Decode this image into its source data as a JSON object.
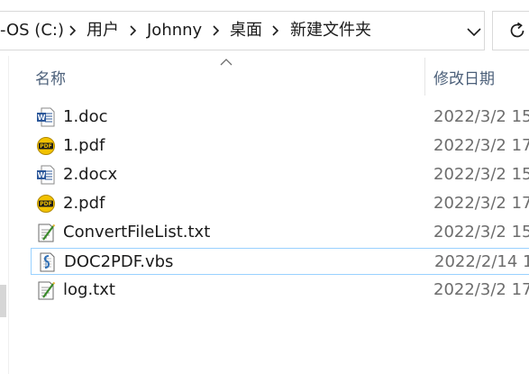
{
  "address_bar": {
    "segments": [
      "-OS (C:)",
      "用户",
      "Johnny",
      "桌面",
      "新建文件夹"
    ],
    "separator_icon": "chevron-right-icon",
    "dropdown_icon": "chevron-down-icon",
    "refresh_icon": "refresh-icon"
  },
  "columns": {
    "name": "名称",
    "date_modified": "修改日期",
    "sort_indicator": "sort-ascending-icon"
  },
  "files": [
    {
      "name": "1.doc",
      "date": "2022/3/2 15",
      "icon": "word-doc-icon",
      "selected": false
    },
    {
      "name": "1.pdf",
      "date": "2022/3/2 17",
      "icon": "pdf-icon",
      "selected": false
    },
    {
      "name": "2.docx",
      "date": "2022/3/2 15",
      "icon": "word-doc-icon",
      "selected": false
    },
    {
      "name": "2.pdf",
      "date": "2022/3/2 17",
      "icon": "pdf-icon",
      "selected": false
    },
    {
      "name": "ConvertFileList.txt",
      "date": "2022/3/2 15",
      "icon": "text-file-icon",
      "selected": false
    },
    {
      "name": "DOC2PDF.vbs",
      "date": "2022/2/14 1",
      "icon": "vbs-script-icon",
      "selected": true
    },
    {
      "name": "log.txt",
      "date": "2022/3/2 17",
      "icon": "text-file-icon",
      "selected": false
    }
  ],
  "colors": {
    "selection_border": "#99d1ff",
    "header_text": "#4c607a",
    "date_text": "#6d6d6d",
    "word_blue": "#2b579a",
    "pdf_yellow": "#f2c200"
  }
}
